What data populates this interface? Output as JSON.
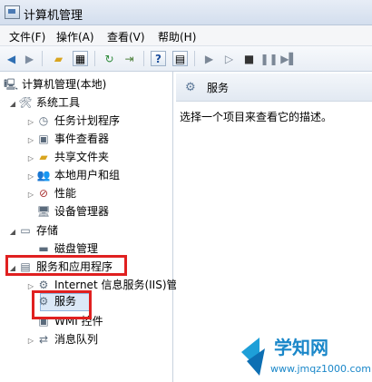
{
  "window": {
    "title": "计算机管理"
  },
  "menu": [
    "文件(F)",
    "操作(A)",
    "查看(V)",
    "帮助(H)"
  ],
  "toolbar": {
    "icons": [
      "back-arrow-icon",
      "forward-arrow-icon",
      "up-folder-icon",
      "show-hide-tree-icon",
      "refresh-icon",
      "export-list-icon",
      "help-icon",
      "properties-icon",
      "play-icon",
      "play-alt-icon",
      "stop-icon",
      "pause-icon",
      "restart-icon"
    ]
  },
  "tree": {
    "root": "计算机管理(本地)",
    "system_tools": "系统工具",
    "task_scheduler": "任务计划程序",
    "event_viewer": "事件查看器",
    "shared_folders": "共享文件夹",
    "local_users": "本地用户和组",
    "performance": "性能",
    "device_manager": "设备管理器",
    "storage": "存储",
    "disk_management": "磁盘管理",
    "services_apps": "服务和应用程序",
    "iis": "Internet 信息服务(IIS)管",
    "services": "服务",
    "wmi": "WMI 控件",
    "message_queue": "消息队列"
  },
  "right_pane": {
    "header": "服务",
    "description": "选择一个项目来查看它的描述。"
  },
  "watermark": {
    "text": "学知网",
    "url": "www.jmqz1000.com"
  },
  "colors": {
    "highlight_box": "#e02020",
    "selection": "#dbe8f7"
  }
}
